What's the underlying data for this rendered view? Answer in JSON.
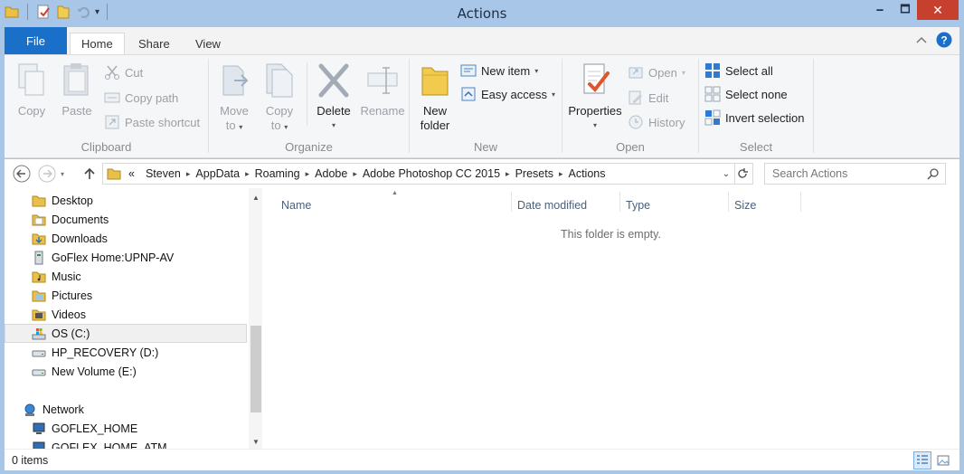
{
  "window": {
    "title": "Actions",
    "minimize_glyph": "🗕",
    "maximize_glyph": "🗖",
    "close_glyph": "✕"
  },
  "tabs": {
    "file": "File",
    "home": "Home",
    "share": "Share",
    "view": "View"
  },
  "ribbon": {
    "clipboard": {
      "label": "Clipboard",
      "copy": "Copy",
      "paste": "Paste",
      "cut": "Cut",
      "copy_path": "Copy path",
      "paste_shortcut": "Paste shortcut"
    },
    "organize": {
      "label": "Organize",
      "move_to_1": "Move",
      "move_to_2": "to",
      "copy_to_1": "Copy",
      "copy_to_2": "to",
      "delete": "Delete",
      "rename": "Rename"
    },
    "new": {
      "label": "New",
      "new_folder_1": "New",
      "new_folder_2": "folder",
      "new_item": "New item",
      "easy_access": "Easy access"
    },
    "open": {
      "label": "Open",
      "properties": "Properties",
      "open": "Open",
      "edit": "Edit",
      "history": "History"
    },
    "select": {
      "label": "Select",
      "select_all": "Select all",
      "select_none": "Select none",
      "invert_selection": "Invert selection"
    }
  },
  "address": {
    "overflow": "«",
    "crumbs": [
      "Steven",
      "AppData",
      "Roaming",
      "Adobe",
      "Adobe Photoshop CC 2015",
      "Presets",
      "Actions"
    ]
  },
  "search": {
    "placeholder": "Search Actions"
  },
  "nav": {
    "items": [
      {
        "label": "Desktop",
        "icon": "folder-icon"
      },
      {
        "label": "Documents",
        "icon": "folder-icon"
      },
      {
        "label": "Downloads",
        "icon": "folder-icon"
      },
      {
        "label": "GoFlex Home:UPNP-AV",
        "icon": "media-server-icon"
      },
      {
        "label": "Music",
        "icon": "folder-icon"
      },
      {
        "label": "Pictures",
        "icon": "folder-icon"
      },
      {
        "label": "Videos",
        "icon": "folder-icon"
      },
      {
        "label": "OS (C:)",
        "icon": "system-drive-icon"
      },
      {
        "label": "HP_RECOVERY (D:)",
        "icon": "drive-icon"
      },
      {
        "label": "New Volume (E:)",
        "icon": "drive-icon"
      },
      {
        "label": "Network",
        "icon": "network-icon"
      },
      {
        "label": "GOFLEX_HOME",
        "icon": "computer-icon"
      },
      {
        "label": "GOFLEX_HOME_ATM",
        "icon": "computer-icon"
      }
    ]
  },
  "columns": {
    "name": "Name",
    "date_modified": "Date modified",
    "type": "Type",
    "size": "Size"
  },
  "empty_message": "This folder is empty.",
  "status": {
    "item_count": "0 items"
  },
  "colors": {
    "accent": "#1a6fc9",
    "frame": "#a9c6e6",
    "close": "#c7402d"
  }
}
